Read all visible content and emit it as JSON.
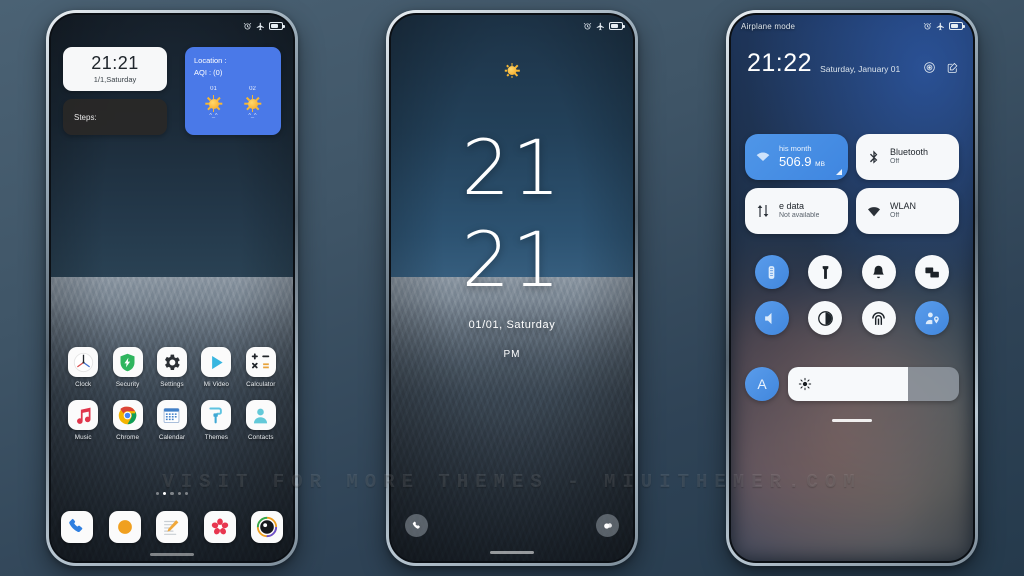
{
  "watermark": "VISIT FOR MORE THEMES - MIUITHEMER.COM",
  "statusbar": {
    "alarm_icon": "alarm-icon",
    "airplane_icon": "airplane-icon",
    "battery_icon": "battery-icon",
    "airplane_label": "Airplane mode"
  },
  "home": {
    "clock_widget": {
      "time": "21:21",
      "date": "1/1,Saturday"
    },
    "steps_widget": {
      "label": "Steps:"
    },
    "weather_widget": {
      "location_label": "Location :",
      "aqi_label": "AQI :  (0)",
      "days": [
        {
          "label": "01",
          "face": "^_^"
        },
        {
          "label": "02",
          "face": "^_^"
        }
      ]
    },
    "apps_row1": [
      {
        "name": "Clock",
        "icon": "clock-icon"
      },
      {
        "name": "Security",
        "icon": "shield-icon"
      },
      {
        "name": "Settings",
        "icon": "gear-icon"
      },
      {
        "name": "Mi Video",
        "icon": "play-icon"
      },
      {
        "name": "Calculator",
        "icon": "calculator-icon"
      }
    ],
    "apps_row2": [
      {
        "name": "Music",
        "icon": "music-note-icon"
      },
      {
        "name": "Chrome",
        "icon": "chrome-icon"
      },
      {
        "name": "Calendar",
        "icon": "calendar-icon"
      },
      {
        "name": "Themes",
        "icon": "paint-roller-icon"
      },
      {
        "name": "Contacts",
        "icon": "person-icon"
      }
    ],
    "dock": [
      {
        "name": "Phone",
        "icon": "phone-icon"
      },
      {
        "name": "Browser",
        "icon": "browser-circle-icon"
      },
      {
        "name": "Notes",
        "icon": "notes-pencil-icon"
      },
      {
        "name": "Gallery",
        "icon": "flower-icon"
      },
      {
        "name": "Camera",
        "icon": "camera-icon"
      }
    ],
    "page_dots": {
      "count": 5,
      "active_index": 1
    }
  },
  "lockscreen": {
    "weather_icon": "sun-icon",
    "hours": "21",
    "minutes": "21",
    "date": "01/01,  Saturday",
    "ampm": "PM",
    "shortcut_left": {
      "name": "Phone",
      "icon": "phone-icon"
    },
    "shortcut_right": {
      "name": "Camera",
      "icon": "camera-lens-icon"
    }
  },
  "controlcenter": {
    "airplane_label": "Airplane mode",
    "time": "21:22",
    "date": "Saturday, January 01",
    "settings_icon": "settings-circle-icon",
    "edit_icon": "edit-icon",
    "tiles": [
      {
        "title": "his month",
        "subtitle": "506.9",
        "unit": "MB",
        "icon": "data-usage-icon",
        "active": true
      },
      {
        "title": "Bluetooth",
        "subtitle": "Off",
        "icon": "bluetooth-icon",
        "active": false
      },
      {
        "title": "e data",
        "subtitle": "Not available",
        "icon": "mobile-data-icon",
        "active": false
      },
      {
        "title": "WLAN",
        "subtitle": "Off",
        "icon": "wifi-icon",
        "active": false
      }
    ],
    "toggles": [
      {
        "name": "airplane-mode",
        "icon": "airplane-toggle-icon",
        "active": true
      },
      {
        "name": "flashlight",
        "icon": "flashlight-icon",
        "active": false
      },
      {
        "name": "ringtone",
        "icon": "bell-icon",
        "active": false
      },
      {
        "name": "screenshot",
        "icon": "screenshot-icon",
        "active": false
      },
      {
        "name": "sound",
        "icon": "sound-icon",
        "active": true
      },
      {
        "name": "dark-mode",
        "icon": "contrast-icon",
        "active": false
      },
      {
        "name": "reading-mode",
        "icon": "reading-mode-icon",
        "active": false
      },
      {
        "name": "location",
        "icon": "location-person-icon",
        "active": true
      }
    ],
    "brightness": {
      "auto_label": "A",
      "icon": "brightness-icon",
      "percent": 70
    }
  },
  "colors": {
    "accent_blue": "#4a79e8",
    "toggle_blue": "#4187dd",
    "tile_white": "#f6f8fa",
    "background": "#3f5567"
  }
}
